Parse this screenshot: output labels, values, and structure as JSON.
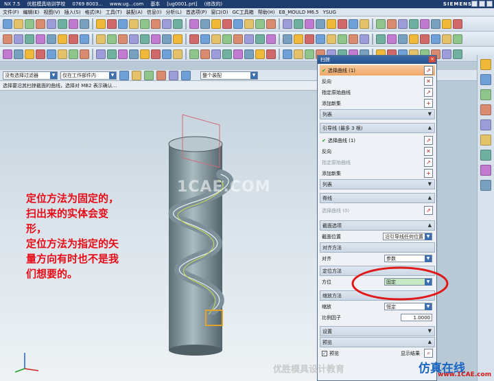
{
  "titlebar": {
    "items": [
      "NX 7.5",
      "优胜模具培训学校",
      "0769 8003...",
      "www.ug...com",
      "基本",
      "[ug0001.prt]",
      "(修改的)"
    ],
    "brand": "SIEMENS"
  },
  "menu": {
    "items": [
      "文件(F)",
      "编辑(E)",
      "视图(V)",
      "插入(S)",
      "格式(R)",
      "工具(T)",
      "装配(A)",
      "信息(I)",
      "分析(L)",
      "首选项(P)",
      "窗口(O)",
      "GC工具箱",
      "帮助(H)",
      "EB_MOULD M6.5",
      "YSUG"
    ]
  },
  "selection_bar": {
    "filter": "没有选择过滤器",
    "scope": "仅在工作部件内",
    "snap": "整个装配"
  },
  "prompt": "选择要沿其扫掠截面的曲线，选择对 MB2 表示确认...",
  "annotation": {
    "lines": [
      "定位方法为固定的，",
      "扫出来的实体会变",
      "形，",
      "定位方法为指定的矢",
      "量方向有时也不是我",
      "们想要的。"
    ]
  },
  "watermark": "1CAE.COM",
  "dialog": {
    "title": "扫掠",
    "section": {
      "select_curve": "选择曲线 (1)",
      "reverse": "反向",
      "specify_origin": "指定原始曲线",
      "add_new_set": "添加新集",
      "list": "列表"
    },
    "guides": {
      "header": "引导线 (最多 3 根)",
      "select_curve": "选择曲线 (1)",
      "reverse": "反向",
      "specify_origin": "指定原始曲线",
      "add_new_set": "添加新集",
      "list": "列表"
    },
    "spine": {
      "header": "脊线",
      "select_curve": "选择曲线 (0)"
    },
    "options": {
      "header": "截面选项",
      "section_position": "截面位置",
      "section_position_value": "沿引导线任何位置",
      "alignment_header": "对齐方法",
      "alignment": "对齐",
      "alignment_value": "参数",
      "orientation_header": "定位方法",
      "orientation": "方位",
      "orientation_value": "固定",
      "scaling_header": "缩放方法",
      "scaling": "缩放",
      "scaling_value": "恒定",
      "scale_factor": "比例因子",
      "scale_factor_value": "1.0000"
    },
    "settings": {
      "header": "设置"
    },
    "preview": {
      "header": "预览",
      "label": "预览",
      "show_result": "显示结果"
    }
  },
  "footer_watermark": "优胜模具设计教育",
  "site_watermark": "仿真在线",
  "site_url": "www.1CAE.com",
  "colors": {
    "annotation": "#e80a16",
    "highlight": "#f2b47d",
    "ellipse": "#e01818"
  }
}
